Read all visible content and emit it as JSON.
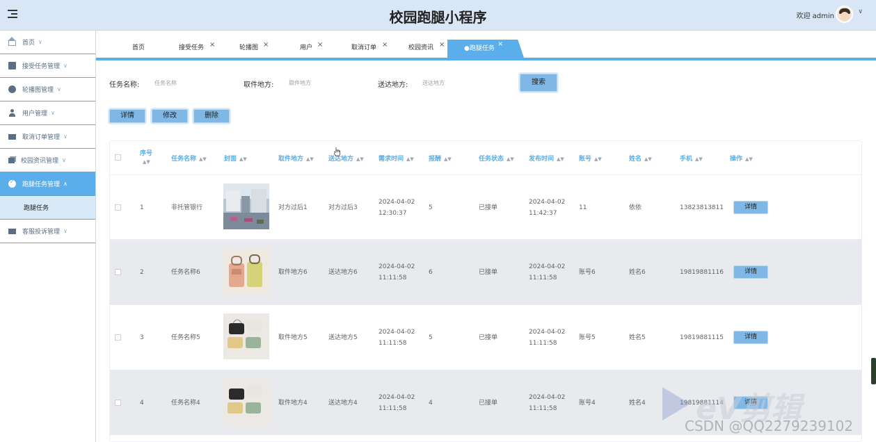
{
  "header": {
    "title": "校园跑腿小程序",
    "welcome": "欢迎 admin"
  },
  "sidebar": {
    "items": [
      {
        "label": "首页",
        "icon": "home-icon"
      },
      {
        "label": "接受任务管理",
        "icon": "book-icon"
      },
      {
        "label": "轮播图管理",
        "icon": "circle-icon"
      },
      {
        "label": "用户管理",
        "icon": "user-icon"
      },
      {
        "label": "取消订单管理",
        "icon": "ticket-icon"
      },
      {
        "label": "校园资讯管理",
        "icon": "files-icon"
      },
      {
        "label": "跑腿任务管理",
        "icon": "check-circle-icon"
      },
      {
        "label": "客服投诉管理",
        "icon": "card-icon"
      }
    ],
    "sub_item": "跑腿任务"
  },
  "tabs": [
    "首页",
    "接受任务",
    "轮播图",
    "用户",
    "取消订单",
    "校园资讯",
    "●跑腿任务"
  ],
  "search": {
    "task_label": "任务名称:",
    "task_placeholder": "任务名称",
    "pickup_label": "取件地方:",
    "pickup_placeholder": "取件地方",
    "deliver_label": "送达地方:",
    "deliver_placeholder": "送达地方",
    "button": "搜索"
  },
  "actions": {
    "detail": "详情",
    "edit": "修改",
    "delete": "删除"
  },
  "table": {
    "headers": [
      "序号",
      "任务名称",
      "封面",
      "取件地方",
      "送达地方",
      "需求时间",
      "报酬",
      "任务状态",
      "发布时间",
      "账号",
      "姓名",
      "手机",
      "操作"
    ],
    "detail_label": "详情",
    "rows": [
      {
        "idx": "1",
        "name": "非托管银行",
        "pickup": "对方过后1",
        "deliver": "对方过后3",
        "need_time": "2024-04-02 12:30:37",
        "reward": "5",
        "status": "已接单",
        "publish_time": "2024-04-02 11:42:37",
        "account": "11",
        "person": "依依",
        "phone": "13823813811"
      },
      {
        "idx": "2",
        "name": "任务名称6",
        "pickup": "取件地方6",
        "deliver": "送达地方6",
        "need_time": "2024-04-02 11:11:58",
        "reward": "6",
        "status": "已接单",
        "publish_time": "2024-04-02 11:11:58",
        "account": "账号6",
        "person": "姓名6",
        "phone": "19819881116"
      },
      {
        "idx": "3",
        "name": "任务名称5",
        "pickup": "取件地方5",
        "deliver": "送达地方5",
        "need_time": "2024-04-02 11:11:58",
        "reward": "5",
        "status": "已接单",
        "publish_time": "2024-04-02 11:11:58",
        "account": "账号5",
        "person": "姓名5",
        "phone": "19819881115"
      },
      {
        "idx": "4",
        "name": "任务名称4",
        "pickup": "取件地方4",
        "deliver": "送达地方4",
        "need_time": "2024-04-02 11:11:58",
        "reward": "4",
        "status": "已接单",
        "publish_time": "2024-04-02 11:11:58",
        "account": "账号4",
        "person": "姓名4",
        "phone": "19819881114"
      }
    ]
  },
  "watermark": {
    "ev": "eV剪辑",
    "csdn": "CSDN @QQ2279239102"
  },
  "colors": {
    "accent": "#5aaee9",
    "button": "#7fb8e6",
    "header_bg": "#d9e6f5"
  }
}
